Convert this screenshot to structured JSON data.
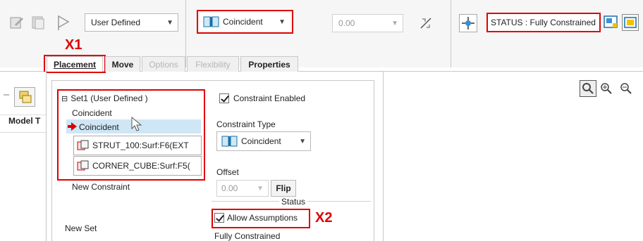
{
  "toolbar": {
    "reference_type": "User Defined",
    "constraint_type": "Coincident",
    "offset_value": "0.00",
    "status": "STATUS : Fully Constrained"
  },
  "annotations": {
    "x1": "X1",
    "x2": "X2"
  },
  "tabs": [
    {
      "label": "Placement",
      "enabled": true
    },
    {
      "label": "Move",
      "enabled": true
    },
    {
      "label": "Options",
      "enabled": false
    },
    {
      "label": "Flexibility",
      "enabled": false
    },
    {
      "label": "Properties",
      "enabled": true
    }
  ],
  "left_panel": {
    "column_header": "Model T"
  },
  "tree": {
    "set_label": "Set1 (User Defined )",
    "collapse_glyph": "⊟",
    "items": [
      "Coincident",
      "Coincident"
    ],
    "references": [
      "STRUT_100:Surf:F6(EXT",
      "CORNER_CUBE:Surf:F5("
    ],
    "new_constraint": "New Constraint",
    "new_set": "New Set"
  },
  "constraint_panel": {
    "enabled_label": "Constraint Enabled",
    "type_label": "Constraint Type",
    "type_value": "Coincident",
    "offset_label": "Offset",
    "offset_value": "0.00",
    "flip_label": "Flip",
    "status_label": "Status",
    "allow_assumptions": "Allow Assumptions",
    "status_value": "Fully Constrained"
  },
  "colors": {
    "annotation_red": "#e00000",
    "selection_blue": "#cfe6f5"
  }
}
